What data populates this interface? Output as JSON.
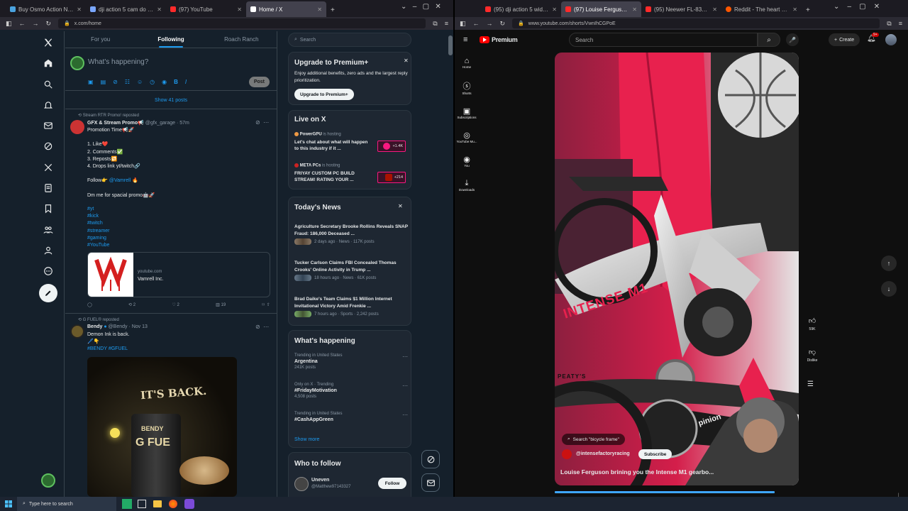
{
  "left_browser": {
    "tabs": [
      {
        "label": "Buy Osmo Action ND Filter Set",
        "color": "#4aa3df"
      },
      {
        "label": "dji action 5 cam do you need n",
        "color": "#7aa7ff"
      },
      {
        "label": "(97) YouTube",
        "color": "#ff2a2a"
      },
      {
        "label": "Home / X",
        "color": "#ffffff",
        "active": true
      }
    ],
    "url": "x.com/home"
  },
  "x": {
    "tabs": [
      "For you",
      "Following",
      "Roach Ranch"
    ],
    "compose_placeholder": "What's happening?",
    "post_label": "Post",
    "show_posts": "Show 41 posts",
    "post1": {
      "repost_line": "Stream RTR Promo! reposted",
      "name": "GFX & Stream Promo📢",
      "handle": "@gfx_garage · 57m",
      "lines": [
        "Promotion Time📢🚀",
        "",
        "1. Like❤️",
        "2. Comments✅",
        "3. Reposts🔁",
        "4. Drops link yt/twitch🔗",
        "",
        "Follow👉 @Vamrell 🔥",
        "",
        "Dm me for spacial promo🤖🚀"
      ],
      "hashtags": [
        "#yt",
        "#kick",
        "#twitch",
        "#streamer",
        "#gaming",
        "#YouTube"
      ],
      "card_domain": "youtube.com",
      "card_title": "Vamrell Inc.",
      "reposts": "2",
      "likes": "2",
      "views": "19"
    },
    "post2": {
      "repost_line": "G FUEL® reposted",
      "name": "Bendy",
      "handle": "@Bendy · Nov 13",
      "text": "Demon Ink is back.",
      "emoji": "🖊️👇",
      "tags": "#BENDY #GFUEL",
      "image_text": "IT'S BACK.",
      "can_text": "BENDY",
      "brand": "G FUE"
    },
    "search_placeholder": "Search",
    "premium": {
      "title": "Upgrade to Premium+",
      "desc": "Enjoy additional benefits, zero ads and the largest reply prioritization.",
      "button": "Upgrade to Premium+"
    },
    "live": {
      "title": "Live on X",
      "items": [
        {
          "host": "PowerGPU",
          "status": "is hosting",
          "title": "Let's chat about what will happen to this industry if it ...",
          "count": "+1.4K"
        },
        {
          "host": "META PCs",
          "status": "is hosting",
          "title": "FRIYAY CUSTOM PC BUILD STREAM! RATING YOUR ...",
          "count": "+214"
        }
      ]
    },
    "news": {
      "title": "Today's News",
      "items": [
        {
          "headline": "Agriculture Secretary Brooke Rollins Reveals SNAP Fraud: 186,000 Deceased ...",
          "meta": "2 days ago · News · 117K posts"
        },
        {
          "headline": "Tucker Carlson Claims FBI Concealed Thomas Crooks' Online Activity in Trump ...",
          "meta": "18 hours ago · News · 61K posts"
        },
        {
          "headline": "Brad Daike's Team Claims $1 Million Internet Invitational Victory Amid Frenkie ...",
          "meta": "7 hours ago · Sports · 2,242 posts"
        }
      ]
    },
    "happening": {
      "title": "What's happening",
      "items": [
        {
          "context": "Trending in United States",
          "name": "Argentina",
          "count": "241K posts"
        },
        {
          "context": "Only on X · Trending",
          "name": "#FridayMotivation",
          "count": "4,508 posts"
        },
        {
          "context": "Trending in United States",
          "name": "#CashAppGreen",
          "count": ""
        }
      ],
      "show_more": "Show more"
    },
    "who": {
      "title": "Who to follow",
      "name": "Uneven",
      "handle": "@Matthew97143327",
      "button": "Follow"
    }
  },
  "right_browser": {
    "tabs": [
      {
        "label": "(95) dji action 5 wide lens - You",
        "color": "#ff2a2a"
      },
      {
        "label": "(97) Louise Ferguson brinin",
        "color": "#ff2a2a",
        "active": true
      },
      {
        "label": "(95) Neewer FL-830 185° FOV (",
        "color": "#ff2a2a"
      },
      {
        "label": "Reddit - The heart of the intern",
        "color": "#ff5700"
      }
    ],
    "url": "www.youtube.com/shorts/VwnIhCGPoE"
  },
  "yt": {
    "logo": "Premium",
    "search_placeholder": "Search",
    "create": "Create",
    "notif_badge": "9+",
    "sidebar": [
      "Home",
      "Shorts",
      "Subscriptions",
      "YouTube Mu...",
      "You",
      "Downloads"
    ],
    "likes": "59K",
    "dislike": "Dislike",
    "search_chip": "Search \"bicycle frame\"",
    "channel": "@intensefactoryracing",
    "subscribe": "Subscribe",
    "video_title": "Louise Ferguson brining you the Intense M1 gearbo...",
    "bike_brand": "INTENSE M1",
    "peaty": "PEATY'S",
    "pinion": "pinion"
  },
  "taskbar": {
    "search": "Type here to search"
  }
}
